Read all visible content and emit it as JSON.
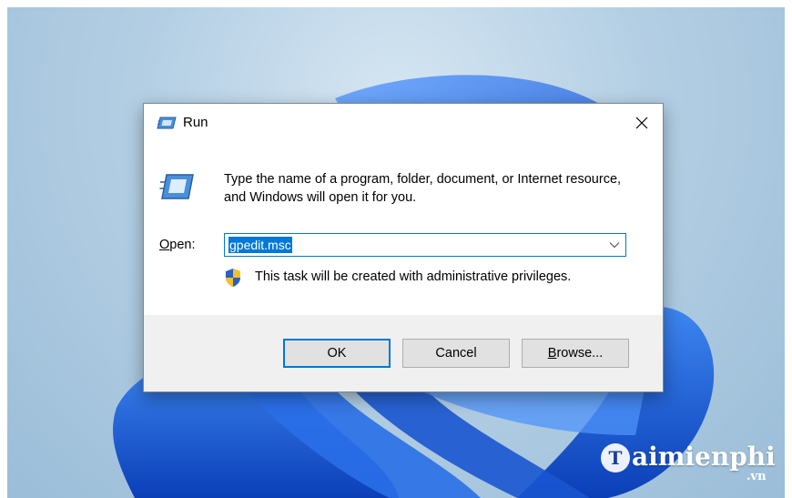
{
  "dialog": {
    "title": "Run",
    "description": "Type the name of a program, folder, document, or Internet resource, and Windows will open it for you.",
    "open_label_accel": "O",
    "open_label_rest": "pen:",
    "input_value": "gpedit.msc",
    "admin_notice": "This task will be created with administrative privileges.",
    "buttons": {
      "ok": "OK",
      "cancel": "Cancel",
      "browse_accel": "B",
      "browse_rest": "rowse..."
    }
  },
  "watermark": {
    "brand": "aimienphi",
    "suffix": ".vn",
    "logo_letter": "T"
  },
  "colors": {
    "accent": "#0078d7",
    "dialog_bg": "#f0f0f0",
    "wallpaper_blue": "#1f5fd6"
  },
  "icons": {
    "title": "run-app-icon",
    "big": "run-app-icon",
    "close": "close-icon",
    "dropdown": "chevron-down-icon",
    "shield": "uac-shield-icon"
  }
}
